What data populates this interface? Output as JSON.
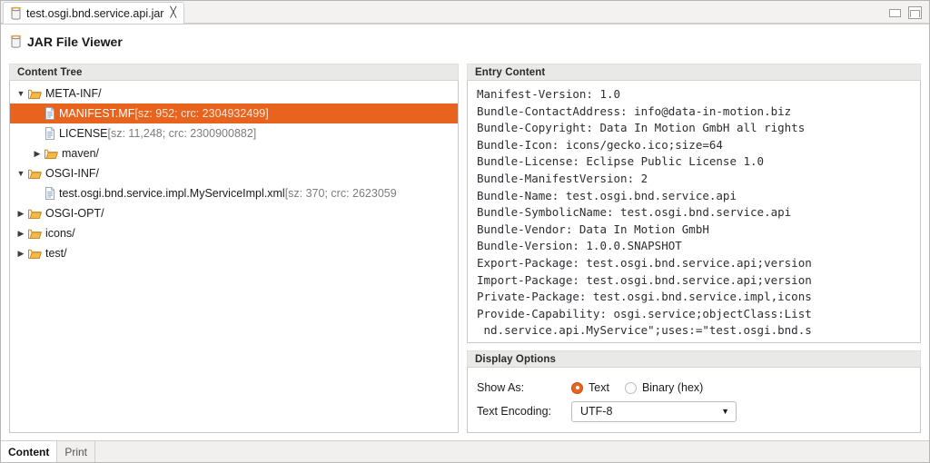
{
  "window": {
    "minimize_label": "Minimize",
    "maximize_label": "Maximize"
  },
  "editor_tab": {
    "icon": "jar-icon",
    "title": "test.osgi.bnd.service.api.jar",
    "close_glyph": "╳"
  },
  "form": {
    "icon": "jar-icon",
    "title": "JAR File Viewer"
  },
  "content_tree": {
    "header": "Content Tree",
    "rows": [
      {
        "indent": 1,
        "twisty": "▼",
        "icon": "folder-open-icon",
        "label": "META-INF/",
        "meta": "",
        "selected": false
      },
      {
        "indent": 2,
        "twisty": "",
        "icon": "file-icon",
        "label": "MANIFEST.MF",
        "meta": " [sz: 952; crc: 2304932499]",
        "selected": true
      },
      {
        "indent": 2,
        "twisty": "",
        "icon": "file-icon",
        "label": "LICENSE",
        "meta": " [sz: 11,248; crc: 2300900882]",
        "selected": false
      },
      {
        "indent": 2,
        "twisty": "▶",
        "icon": "folder-open-icon",
        "label": "maven/",
        "meta": "",
        "selected": false
      },
      {
        "indent": 1,
        "twisty": "▼",
        "icon": "folder-open-icon",
        "label": "OSGI-INF/",
        "meta": "",
        "selected": false
      },
      {
        "indent": 2,
        "twisty": "",
        "icon": "file-icon",
        "label": "test.osgi.bnd.service.impl.MyServiceImpl.xml",
        "meta": " [sz: 370; crc: 2623059",
        "selected": false
      },
      {
        "indent": 1,
        "twisty": "▶",
        "icon": "folder-open-icon",
        "label": "OSGI-OPT/",
        "meta": "",
        "selected": false
      },
      {
        "indent": 1,
        "twisty": "▶",
        "icon": "folder-open-icon",
        "label": "icons/",
        "meta": "",
        "selected": false
      },
      {
        "indent": 1,
        "twisty": "▶",
        "icon": "folder-open-icon",
        "label": "test/",
        "meta": "",
        "selected": false
      }
    ]
  },
  "entry_content": {
    "header": "Entry Content",
    "text": "Manifest-Version: 1.0\nBundle-ContactAddress: info@data-in-motion.biz\nBundle-Copyright: Data In Motion GmbH all rights\nBundle-Icon: icons/gecko.ico;size=64\nBundle-License: Eclipse Public License 1.0\nBundle-ManifestVersion: 2\nBundle-Name: test.osgi.bnd.service.api\nBundle-SymbolicName: test.osgi.bnd.service.api\nBundle-Vendor: Data In Motion GmbH\nBundle-Version: 1.0.0.SNAPSHOT\nExport-Package: test.osgi.bnd.service.api;version\nImport-Package: test.osgi.bnd.service.api;version\nPrivate-Package: test.osgi.bnd.service.impl,icons\nProvide-Capability: osgi.service;objectClass:List\n nd.service.api.MyService\";uses:=\"test.osgi.bnd.s"
  },
  "display_options": {
    "header": "Display Options",
    "show_as_label": "Show As:",
    "radios": [
      {
        "label": "Text",
        "checked": true
      },
      {
        "label": "Binary (hex)",
        "checked": false
      }
    ],
    "encoding_label": "Text Encoding:",
    "encoding_value": "UTF-8",
    "encoding_arrow": "▼"
  },
  "bottom_tabs": [
    {
      "label": "Content",
      "active": true
    },
    {
      "label": "Print",
      "active": false
    }
  ],
  "colors": {
    "selection": "#e8641e",
    "section_header_bg": "#e9e9e7",
    "panel_border": "#c8c8c6",
    "folder": "#f0a848"
  }
}
